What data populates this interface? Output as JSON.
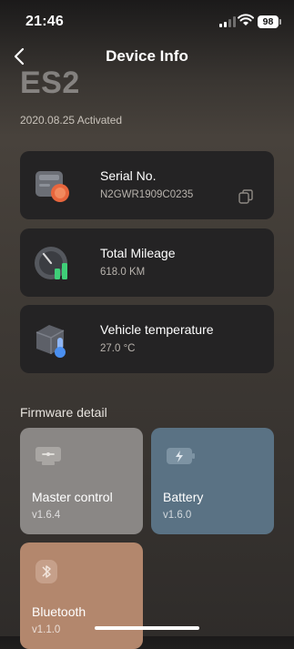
{
  "status_bar": {
    "time": "21:46",
    "battery_level": "98"
  },
  "nav": {
    "title": "Device Info",
    "back_icon": "chevron-left-icon"
  },
  "device": {
    "model": "ES2",
    "activated": "2020.08.25 Activated"
  },
  "info_cards": [
    {
      "title": "Serial No.",
      "value": "N2GWR1909C0235",
      "icon": "scooter-module-icon"
    },
    {
      "title": "Total Mileage",
      "value": "618.0 KM",
      "icon": "speedometer-icon"
    },
    {
      "title": "Vehicle temperature",
      "value": "27.0 °C",
      "icon": "thermometer-icon"
    }
  ],
  "firmware": {
    "section_title": "Firmware detail",
    "items": [
      {
        "name": "Master control",
        "version": "v1.6.4",
        "color": "#8a8785"
      },
      {
        "name": "Battery",
        "version": "v1.6.0",
        "color": "#5a7284"
      },
      {
        "name": "Bluetooth",
        "version": "v1.1.0",
        "color": "#b3876d"
      }
    ]
  },
  "colors": {
    "card_bg": "#242324",
    "accent_orange": "#e8663d",
    "accent_green": "#3fcf78",
    "accent_blue": "#4a8ff0"
  }
}
